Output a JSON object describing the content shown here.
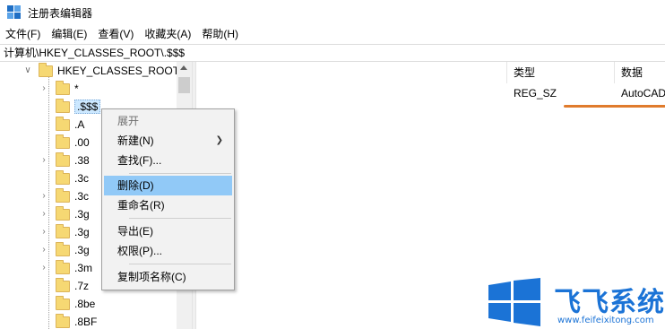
{
  "window": {
    "title": "注册表编辑器",
    "icon": "regedit-icon"
  },
  "menu": {
    "items": [
      "文件(F)",
      "编辑(E)",
      "查看(V)",
      "收藏夹(A)",
      "帮助(H)"
    ]
  },
  "address": {
    "path": "计算机\\HKEY_CLASSES_ROOT\\.$$$"
  },
  "tree": {
    "root": "HKEY_CLASSES_ROOT",
    "items": [
      {
        "label": "*",
        "expandable": true
      },
      {
        "label": ".$$$",
        "expandable": false,
        "selected": true
      },
      {
        "label": ".A",
        "expandable": false
      },
      {
        "label": ".00",
        "expandable": false
      },
      {
        "label": ".38",
        "expandable": true
      },
      {
        "label": ".3c",
        "expandable": false
      },
      {
        "label": ".3c",
        "expandable": true
      },
      {
        "label": ".3g",
        "expandable": true
      },
      {
        "label": ".3g",
        "expandable": true
      },
      {
        "label": ".3g",
        "expandable": true
      },
      {
        "label": ".3m",
        "expandable": true
      },
      {
        "label": ".7z",
        "expandable": false
      },
      {
        "label": ".8be",
        "expandable": false
      },
      {
        "label": ".8BF",
        "expandable": false
      }
    ]
  },
  "values": {
    "columns": [
      "类型",
      "数据"
    ],
    "rows": [
      {
        "type": "REG_SZ",
        "data": "AutoCAD"
      }
    ],
    "highlight_color": "#e07b2c"
  },
  "context_menu": {
    "items": [
      {
        "label": "展开",
        "disabled": true
      },
      {
        "label": "新建(N)",
        "submenu": true
      },
      {
        "label": "查找(F)..."
      },
      {
        "label": "删除(D)",
        "highlighted": true
      },
      {
        "label": "重命名(R)"
      },
      {
        "label": "导出(E)"
      },
      {
        "label": "权限(P)..."
      },
      {
        "label": "复制项名称(C)"
      }
    ],
    "highlight_color": "#91c9f7"
  },
  "watermark": {
    "brand": "飞飞系统",
    "url": "www.feifeixitong.com",
    "color": "#1b73d6"
  }
}
